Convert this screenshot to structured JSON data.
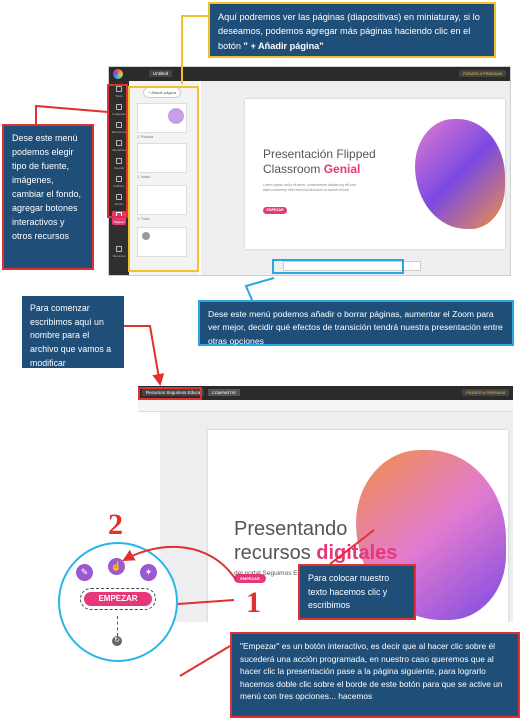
{
  "callouts": {
    "thumbnails": {
      "text_before": "Aquí podremos ver las páginas (diapositivas) en miniaturay, si lo deseamos, podemos  agregar más páginas haciendo clic en el botón ",
      "text_bold": "\" + Añadir página\""
    },
    "left_menu": "Dese  este menú podemos elegir tipo de fuente, imágenes, cambiar el fondo, agregar botones interactivos y otros recursos",
    "bottom_menu": "Dese este menú podemos añadir o borrar páginas, aumentar el Zoom para ver mejor, decidir qué efectos de transición tendrá nuestra presentación entre otras opciones",
    "filename": "Para comenzar escribimos aquí un nombre para el archivo que vamos a modificar",
    "text": "Para colocar nuestro texto hacemos clic y escribimos",
    "button": "\"Empezar\"  es un botón interactivo, es decir que al hacer clic sobre él sucederá una acción programada, en nuestro caso queremos  que al hacer clic la presentación pase a la página siguiente, para lograrlo hacemos doble clic sobre el borde de este botón para que se active un menú con tres opciones... hacemos"
  },
  "editor1": {
    "file_title": "Untitled",
    "premium": "PÁSATE A PREMIUM",
    "add_page": "+ Añadir página",
    "sidebar": [
      "Texto",
      "Imágenes",
      "Elementos",
      "Interactividad",
      "Insertar",
      "Gráficos",
      "Fondo",
      "Páginas",
      "Recursos"
    ],
    "thumbs": [
      "1. Portada",
      "2. Índice",
      "3. Título"
    ],
    "slide": {
      "title1": "Presentación Flipped",
      "title2a": "Classroom ",
      "title2b": "Genial",
      "body": "Lorem ipsum dolor sit amet, consectetuer adipiscing elit sed diam nonummy nibh euismod tincidunt ut laoreet dolore",
      "button": "EMPEZAR"
    }
  },
  "editor2": {
    "file_title": "Recursos Seguimos Educa",
    "share": "COMPARTIR",
    "premium": "PÁSATE A PREMIUM",
    "title1": "Presentando",
    "title2a": "recursos ",
    "title2b": "digitales",
    "subtitle": "del portal Seguimos Educand",
    "button": "EMPEZAR"
  },
  "zoom": {
    "button": "EMPEZAR"
  },
  "numbers": {
    "one": "1",
    "two": "2"
  },
  "colors": {
    "callout": "#1f4e79",
    "pink": "#e5387a",
    "red": "#e03030",
    "yellow": "#f2c12e",
    "blue": "#2aa7e0"
  }
}
